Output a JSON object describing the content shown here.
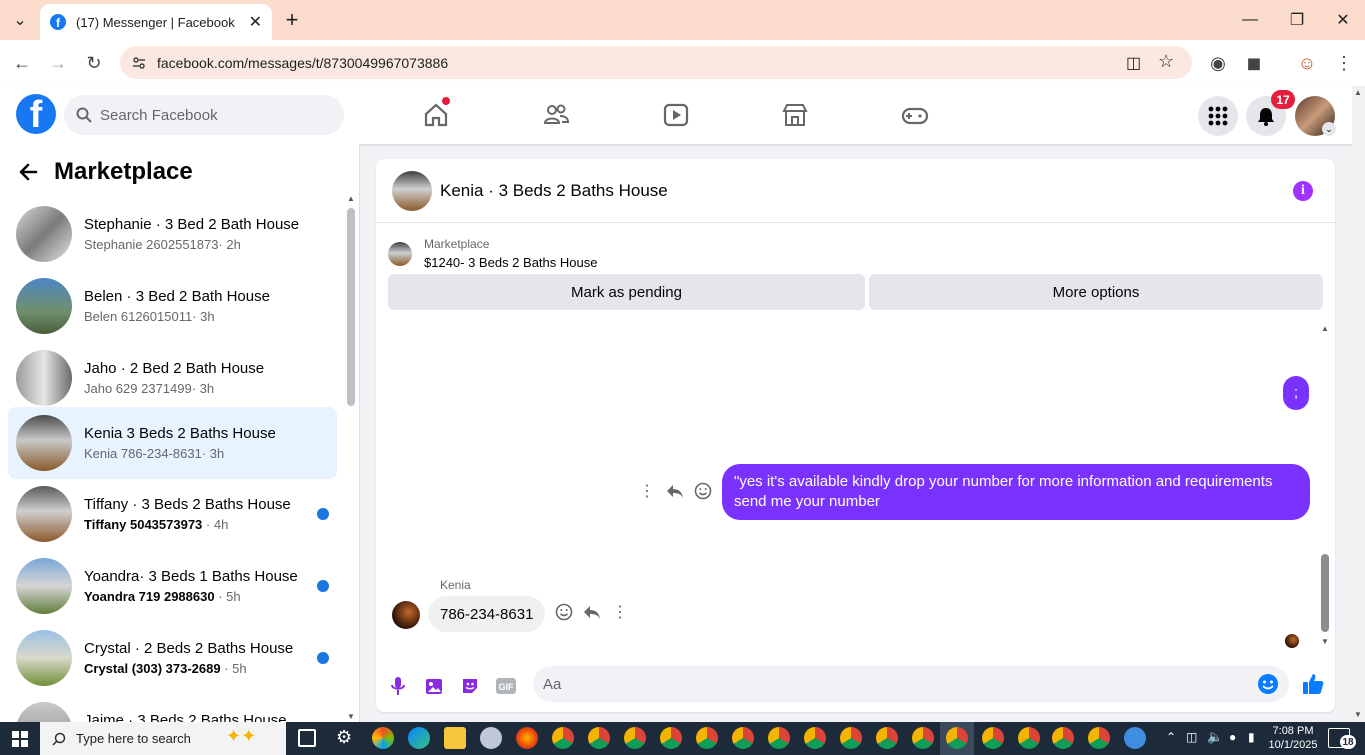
{
  "browser": {
    "tab_title": "(17) Messenger | Facebook",
    "url": "facebook.com/messages/t/8730049967073886"
  },
  "header": {
    "search_placeholder": "Search Facebook",
    "notification_count": "17"
  },
  "sidebar": {
    "title": "Marketplace",
    "conversations": [
      {
        "name": "Stephanie · 3 Bed 2 Bath House",
        "meta": "Stephanie 2602551873",
        "time": "· 2h",
        "unread": false
      },
      {
        "name": "Belen · 3 Bed 2 Bath House",
        "meta": "Belen 6126015011",
        "time": "· 3h",
        "unread": false
      },
      {
        "name": "Jaho · 2 Bed 2 Bath House",
        "meta": "Jaho 629 2371499",
        "time": "· 3h",
        "unread": false
      },
      {
        "name": "Kenia 3 Beds 2 Baths House",
        "meta": "Kenia 786-234-8631",
        "time": "· 3h",
        "unread": false,
        "active": true
      },
      {
        "name": "Tiffany · 3 Beds 2 Baths House",
        "meta": "Tiffany 5043573973",
        "time": " · 4h",
        "unread": true
      },
      {
        "name": "Yoandra· 3 Beds 1 Baths House",
        "meta": "Yoandra 719 2988630",
        "time": " · 5h",
        "unread": true
      },
      {
        "name": "Crystal · 2 Beds 2 Baths House",
        "meta": "Crystal (303) 373-2689",
        "time": " · 5h",
        "unread": true
      },
      {
        "name": "Jaime · 3 Beds 2 Baths House",
        "meta": "",
        "time": "",
        "unread": false
      }
    ]
  },
  "chat": {
    "title": "Kenia · 3 Beds 2 Baths House",
    "marketplace_label": "Marketplace",
    "listing": "$1240- 3 Beds 2 Baths House",
    "mark_pending": "Mark as pending",
    "more_options": "More options",
    "messages": {
      "out_short": ";",
      "out_long": "\"yes it's available kindly drop your number for more information and requirements send me your number",
      "in_sender": "Kenia",
      "in_text": "786-234-8631"
    },
    "composer_placeholder": "Aa"
  },
  "taskbar": {
    "search_placeholder": "Type here to search",
    "time": "7:08 PM",
    "date": "10/1/2025",
    "notif": "18"
  },
  "colors": {
    "fb_blue": "#1877f2",
    "outgoing_bubble": "#7a32ff",
    "unread_dot": "#1b74e4",
    "badge_red": "#e41e3f"
  }
}
